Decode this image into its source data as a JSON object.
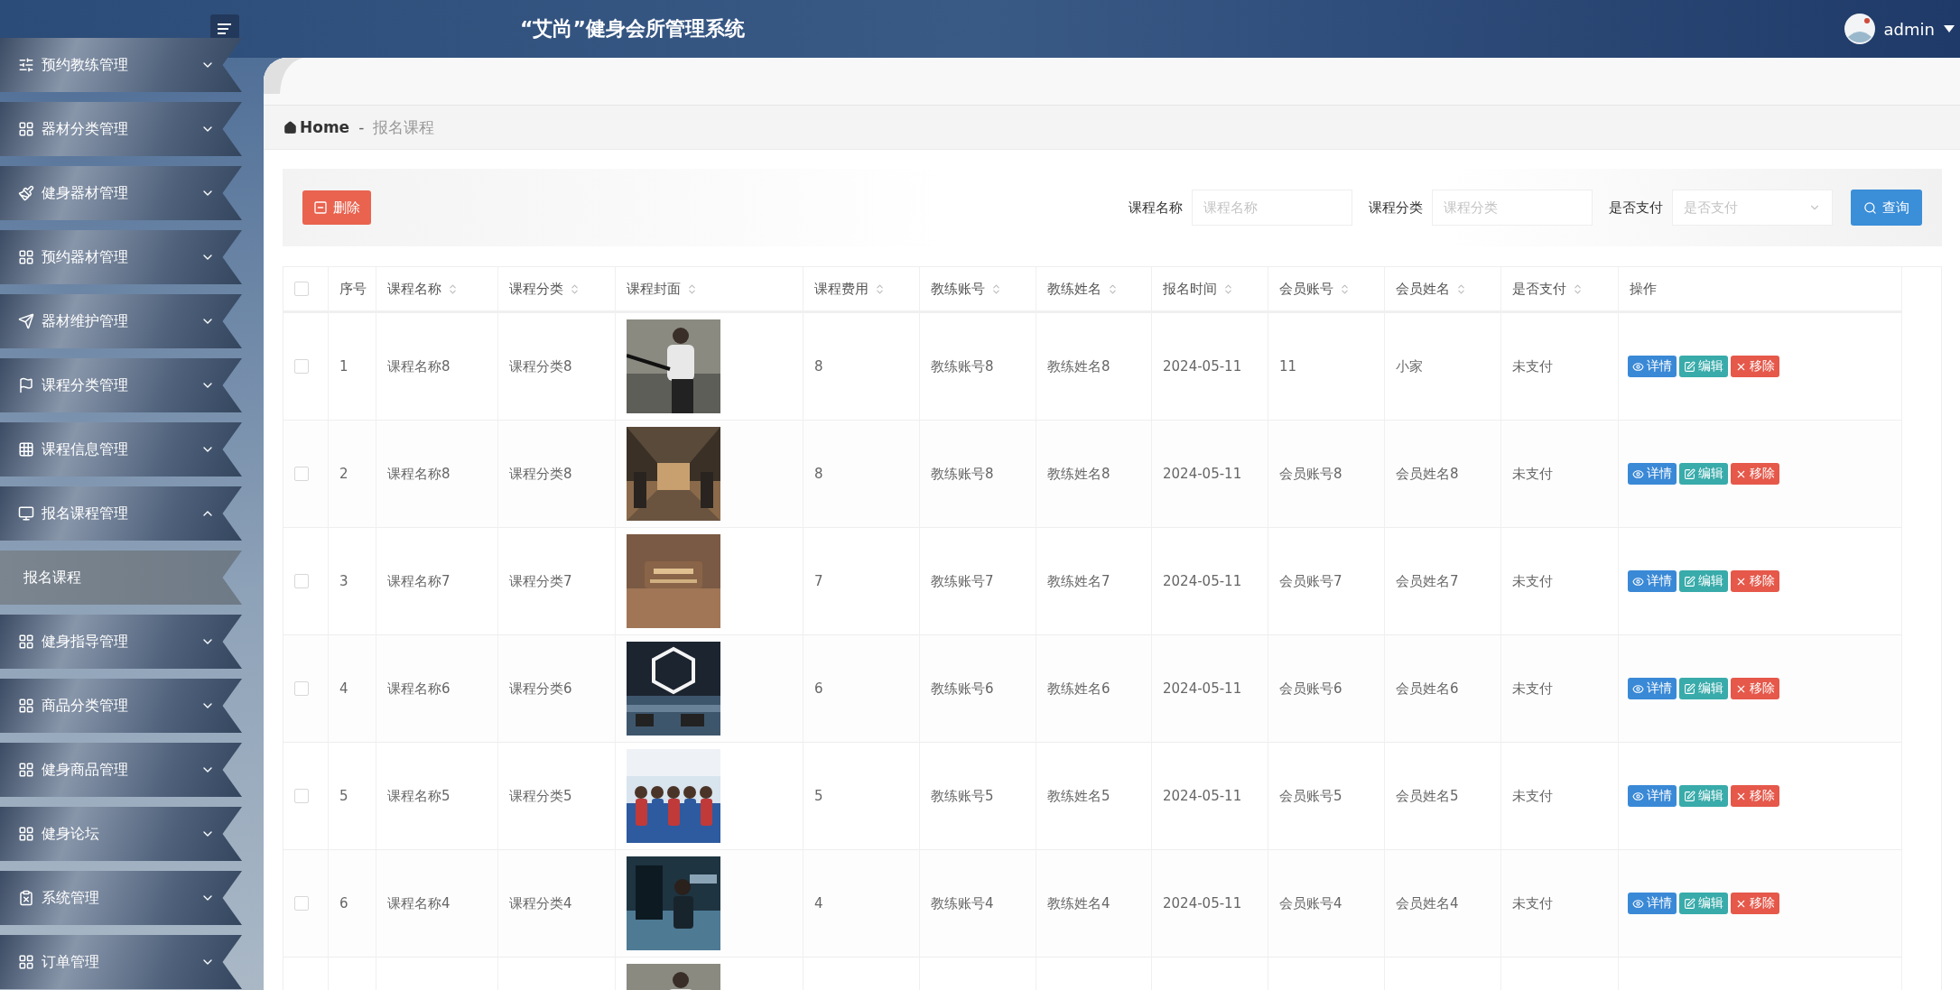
{
  "header": {
    "title": "“艾尚”健身会所管理系统",
    "user": "admin"
  },
  "sidebar": {
    "items": [
      {
        "label": "预约教练管理",
        "expanded": false
      },
      {
        "label": "器材分类管理",
        "expanded": false
      },
      {
        "label": "健身器材管理",
        "expanded": false
      },
      {
        "label": "预约器材管理",
        "expanded": false
      },
      {
        "label": "器材维护管理",
        "expanded": false
      },
      {
        "label": "课程分类管理",
        "expanded": false
      },
      {
        "label": "课程信息管理",
        "expanded": false
      },
      {
        "label": "报名课程管理",
        "expanded": true,
        "children": [
          {
            "label": "报名课程",
            "selected": true
          }
        ]
      },
      {
        "label": "健身指导管理",
        "expanded": false
      },
      {
        "label": "商品分类管理",
        "expanded": false
      },
      {
        "label": "健身商品管理",
        "expanded": false
      },
      {
        "label": "健身论坛",
        "expanded": false
      },
      {
        "label": "系统管理",
        "expanded": false
      },
      {
        "label": "订单管理",
        "expanded": false
      }
    ]
  },
  "breadcrumb": {
    "home": "Home",
    "separator": "-",
    "current": "报名课程"
  },
  "toolbar": {
    "delete_button": "删除",
    "filters": [
      {
        "label": "课程名称",
        "placeholder": "课程名称",
        "kind": "input"
      },
      {
        "label": "课程分类",
        "placeholder": "课程分类",
        "kind": "input"
      },
      {
        "label": "是否支付",
        "placeholder": "是否支付",
        "kind": "select"
      }
    ],
    "search_button": "查询"
  },
  "table": {
    "select_all_checked": false,
    "columns": [
      {
        "label": "序号",
        "sortable": false
      },
      {
        "label": "课程名称",
        "sortable": true
      },
      {
        "label": "课程分类",
        "sortable": true
      },
      {
        "label": "课程封面",
        "sortable": true
      },
      {
        "label": "课程费用",
        "sortable": true
      },
      {
        "label": "教练账号",
        "sortable": true
      },
      {
        "label": "教练姓名",
        "sortable": true
      },
      {
        "label": "报名时间",
        "sortable": true
      },
      {
        "label": "会员账号",
        "sortable": true
      },
      {
        "label": "会员姓名",
        "sortable": true
      },
      {
        "label": "是否支付",
        "sortable": true
      },
      {
        "label": "操作",
        "sortable": false
      }
    ],
    "rows": [
      {
        "checked": false,
        "actions": [
          "详情",
          "编辑",
          "移除"
        ],
        "cells": [
          "1",
          "课程名称8",
          "课程分类8",
          "",
          "8",
          "教练账号8",
          "教练姓名8",
          "2024-05-11",
          "11",
          "小家",
          "未支付"
        ]
      },
      {
        "checked": false,
        "actions": [
          "详情",
          "编辑",
          "移除"
        ],
        "cells": [
          "2",
          "课程名称8",
          "课程分类8",
          "",
          "8",
          "教练账号8",
          "教练姓名8",
          "2024-05-11",
          "会员账号8",
          "会员姓名8",
          "未支付"
        ]
      },
      {
        "checked": false,
        "actions": [
          "详情",
          "编辑",
          "移除"
        ],
        "cells": [
          "3",
          "课程名称7",
          "课程分类7",
          "",
          "7",
          "教练账号7",
          "教练姓名7",
          "2024-05-11",
          "会员账号7",
          "会员姓名7",
          "未支付"
        ]
      },
      {
        "checked": false,
        "actions": [
          "详情",
          "编辑",
          "移除"
        ],
        "cells": [
          "4",
          "课程名称6",
          "课程分类6",
          "",
          "6",
          "教练账号6",
          "教练姓名6",
          "2024-05-11",
          "会员账号6",
          "会员姓名6",
          "未支付"
        ]
      },
      {
        "checked": false,
        "actions": [
          "详情",
          "编辑",
          "移除"
        ],
        "cells": [
          "5",
          "课程名称5",
          "课程分类5",
          "",
          "5",
          "教练账号5",
          "教练姓名5",
          "2024-05-11",
          "会员账号5",
          "会员姓名5",
          "未支付"
        ]
      },
      {
        "checked": false,
        "actions": [
          "详情",
          "编辑",
          "移除"
        ],
        "cells": [
          "6",
          "课程名称4",
          "课程分类4",
          "",
          "4",
          "教练账号4",
          "教练姓名4",
          "2024-05-11",
          "会员账号4",
          "会员姓名4",
          "未支付"
        ]
      }
    ]
  }
}
